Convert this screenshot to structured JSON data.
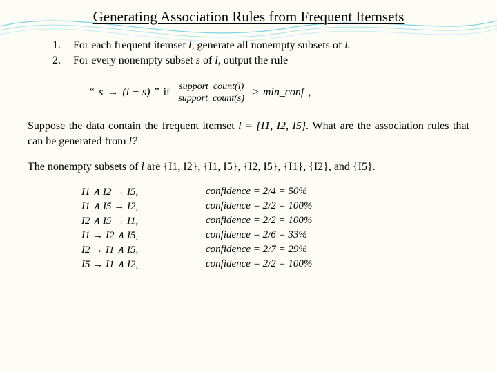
{
  "title": "Generating Association Rules from Frequent Itemsets",
  "steps": {
    "n1": "1.",
    "n2": "2.",
    "t1a": "For each frequent itemset ",
    "t1l": "l,",
    "t1b": " generate all nonempty subsets of ",
    "t1l2": "l.",
    "t2a": "For every nonempty subset ",
    "t2s": "s",
    "t2b": " of ",
    "t2l": "l,",
    "t2c": " output the rule"
  },
  "formula": {
    "lquote": "“",
    "s": "s",
    "arrow": " → ",
    "diff": "(l − s)",
    "rquote": "”",
    "if": " if ",
    "frac_top": "support_count(l)",
    "frac_bot": "support_count(s)",
    "geq": " ≥ ",
    "minconf": "min_conf",
    "comma": ","
  },
  "para1a": "Suppose the data contain the frequent itemset ",
  "para1b": "l = {I1, I2, I5}.",
  "para1c": " What are the association rules that can be generated from ",
  "para1d": "l?",
  "para2a": "The nonempty subsets of ",
  "para2b": "l",
  "para2c": " are {I1, I2}, {I1, I5}, {I2, I5}, {I1}, {I2}, and {I5}.",
  "rules": [
    {
      "lhs": "I1 ∧ I2 → I5,",
      "rhs": "confidence = 2/4 = 50%"
    },
    {
      "lhs": "I1 ∧ I5 → I2,",
      "rhs": "confidence = 2/2 = 100%"
    },
    {
      "lhs": "I2 ∧ I5 → I1,",
      "rhs": "confidence = 2/2 = 100%"
    },
    {
      "lhs": "I1 → I2 ∧ I5,",
      "rhs": "confidence = 2/6 = 33%"
    },
    {
      "lhs": "I2 → I1 ∧ I5,",
      "rhs": "confidence = 2/7 = 29%"
    },
    {
      "lhs": "I5 → I1 ∧ I2,",
      "rhs": "confidence = 2/2 = 100%"
    }
  ]
}
